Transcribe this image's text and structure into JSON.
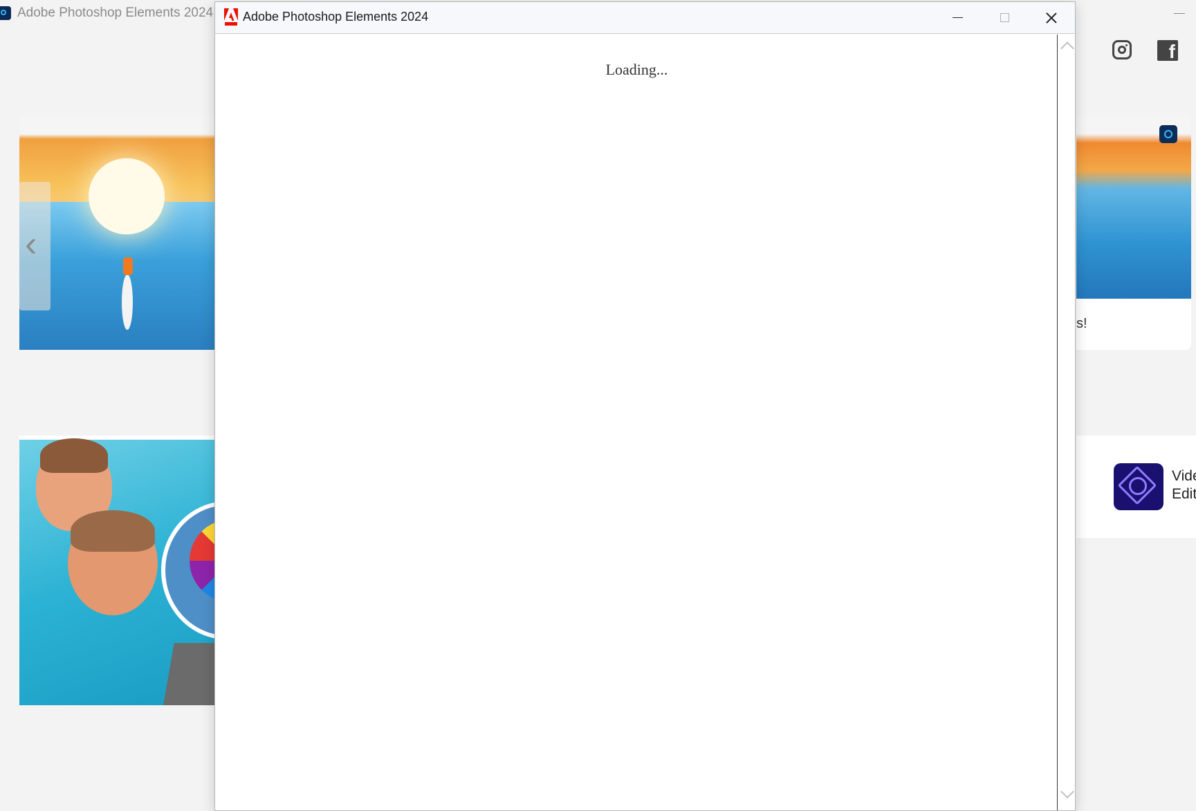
{
  "background_app": {
    "title": "Adobe Photoshop Elements 2024",
    "icons": [
      "photoshop-elements-icon",
      "instagram-icon",
      "facebook-icon",
      "chevron-left-icon",
      "premiere-elements-icon"
    ],
    "right_card_text_fragment": "s!",
    "video_card_label_line1": "Vide",
    "video_card_label_line2": "Edit"
  },
  "dialog": {
    "title": "Adobe Photoshop Elements 2024",
    "logo_icon": "adobe-logo-icon",
    "controls": [
      "minimize",
      "maximize",
      "close"
    ],
    "loading_text": "Loading..."
  },
  "colors": {
    "adobe_red": "#eb1000",
    "page_background": "#f3f3f3",
    "premiere_icon_bg": "#1a1070"
  }
}
